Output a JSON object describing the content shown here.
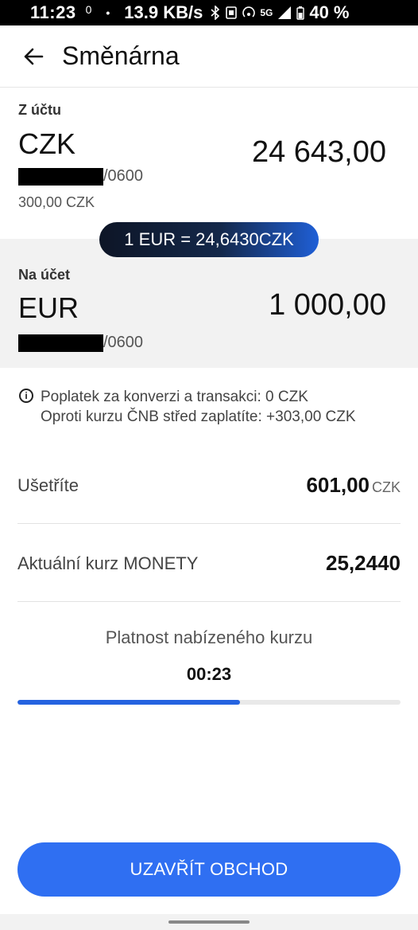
{
  "status_bar": {
    "time": "11:23",
    "temp": "0",
    "separator": "•",
    "speed": "13.9 KB/s",
    "network": "5G",
    "battery": "40 %"
  },
  "header": {
    "back_icon": "arrow-left-icon",
    "title": "Směnárna"
  },
  "from": {
    "label": "Z účtu",
    "currency": "CZK",
    "amount": "24 643,00",
    "account_suffix": "/0600",
    "balance": "300,00 CZK"
  },
  "rate_pill": "1 EUR = 24,6430CZK",
  "to": {
    "label": "Na účet",
    "currency": "EUR",
    "amount": "1 000,00",
    "account_suffix": "/0600"
  },
  "info": {
    "icon": "info-icon",
    "line1": "Poplatek za konverzi a transakci: 0 CZK",
    "line2": "Oproti kurzu ČNB střed zaplatíte: +303,00 CZK"
  },
  "savings": {
    "label": "Ušetříte",
    "value": "601,00",
    "unit": "CZK"
  },
  "rate_row": {
    "label": "Aktuální kurz MONETY",
    "value": "25,2440"
  },
  "validity": {
    "label": "Platnost nabízeného kurzu",
    "countdown": "00:23",
    "progress_fraction": 0.58
  },
  "cta": {
    "label": "UZAVŘÍT OBCHOD"
  },
  "colors": {
    "accent": "#2f6ff2",
    "progress": "#2563e0",
    "pill_dark": "#0d1526"
  }
}
